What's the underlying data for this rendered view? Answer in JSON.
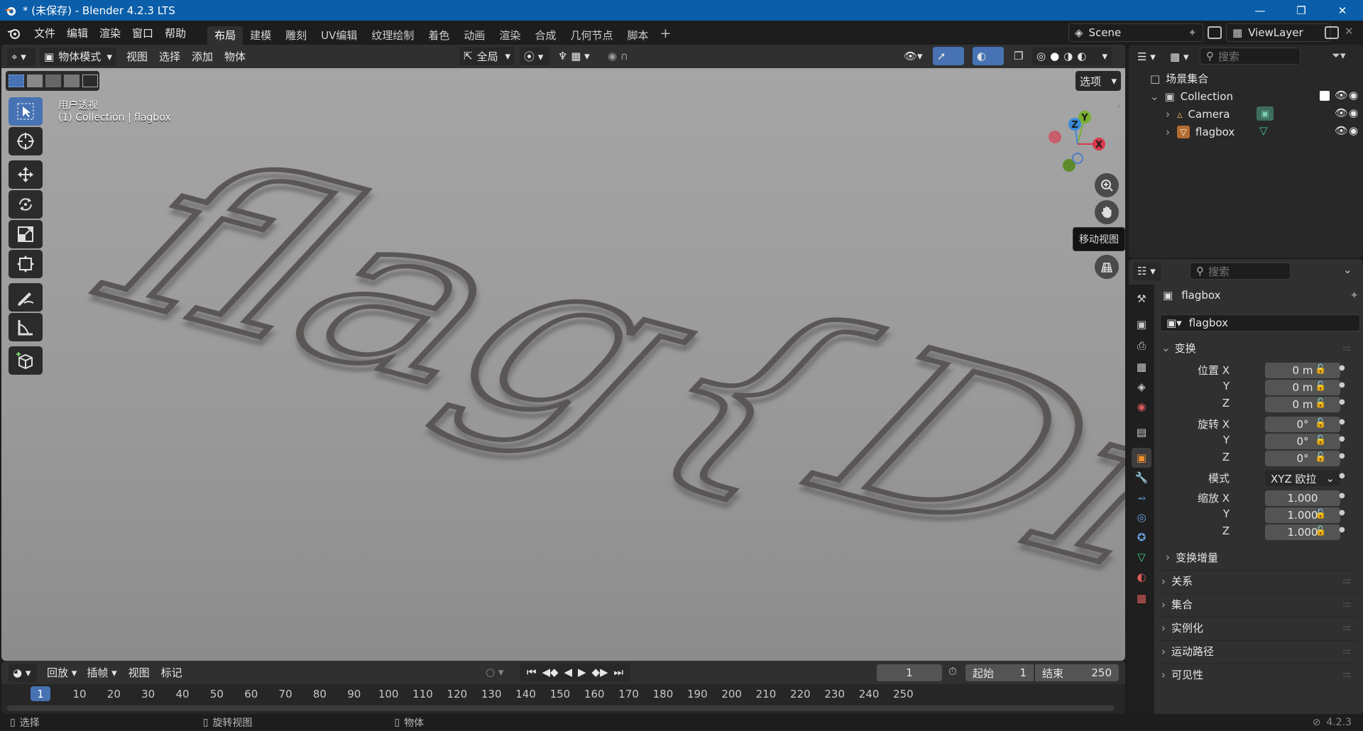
{
  "window": {
    "title": "* (未保存) - Blender 4.2.3 LTS"
  },
  "menu": {
    "file": "文件",
    "edit": "编辑",
    "render": "渲染",
    "window": "窗口",
    "help": "帮助"
  },
  "workspaces": [
    "布局",
    "建模",
    "雕刻",
    "UV编辑",
    "纹理绘制",
    "着色",
    "动画",
    "渲染",
    "合成",
    "几何节点",
    "脚本"
  ],
  "topright": {
    "scene": "Scene",
    "view_layer": "ViewLayer"
  },
  "viewport": {
    "mode": "物体模式",
    "menus": [
      "视图",
      "选择",
      "添加",
      "物体"
    ],
    "transform_orientation": "全局",
    "options": "选项",
    "view_name": "用户透视",
    "view_sub": "(1) Collection | flagbox",
    "tooltip": "移动视图",
    "text_3d": "flag{Dr"
  },
  "gizmo": {
    "x": "X",
    "y": "Y",
    "z": "Z"
  },
  "outliner": {
    "search_placeholder": "搜索",
    "scene_collection": "场景集合",
    "items": [
      {
        "name": "Collection"
      },
      {
        "name": "Camera"
      },
      {
        "name": "flagbox"
      }
    ]
  },
  "properties": {
    "search_placeholder": "搜索",
    "object_name": "flagbox",
    "datablock": "flagbox",
    "transform_section": "变换",
    "location_label": "位置 X",
    "rotation_label": "旋转 X",
    "scale_label": "缩放 X",
    "axis_y": "Y",
    "axis_z": "Z",
    "location": [
      "0 m",
      "0 m",
      "0 m"
    ],
    "rotation": [
      "0°",
      "0°",
      "0°"
    ],
    "mode_label": "模式",
    "rotation_mode": "XYZ 欧拉",
    "scale": [
      "1.000",
      "1.000",
      "1.000"
    ],
    "delta_transform": "变换增量",
    "sections": [
      "关系",
      "集合",
      "实例化",
      "运动路径",
      "可见性"
    ]
  },
  "timeline": {
    "playback": "回放",
    "keying": "插帧",
    "view": "视图",
    "marker": "标记",
    "current_frame": "1",
    "start_label": "起始",
    "start": "1",
    "end_label": "结束",
    "end": "250",
    "frame_marks": [
      "10",
      "20",
      "30",
      "40",
      "50",
      "60",
      "70",
      "80",
      "90",
      "100",
      "110",
      "120",
      "130",
      "140",
      "150",
      "160",
      "170",
      "180",
      "190",
      "200",
      "210",
      "220",
      "230",
      "240",
      "250"
    ]
  },
  "status": {
    "select": "选择",
    "rotate_view": "旋转视图",
    "object": "物体",
    "version": "4.2.3"
  }
}
